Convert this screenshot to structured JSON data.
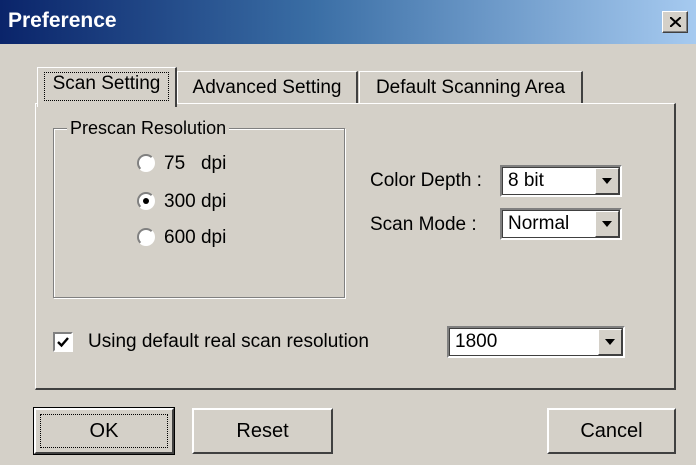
{
  "window": {
    "title": "Preference",
    "close_glyph": "×"
  },
  "tabs": [
    {
      "label": "Scan Setting",
      "active": true
    },
    {
      "label": "Advanced Setting",
      "active": false
    },
    {
      "label": "Default Scanning Area",
      "active": false
    }
  ],
  "prescan": {
    "title": "Prescan Resolution",
    "options": [
      {
        "label": "75   dpi",
        "selected": false
      },
      {
        "label": "300 dpi",
        "selected": true
      },
      {
        "label": "600 dpi",
        "selected": false
      }
    ]
  },
  "color_depth": {
    "label": "Color Depth :",
    "value": "8 bit"
  },
  "scan_mode": {
    "label": "Scan Mode :",
    "value": "Normal"
  },
  "real_scan": {
    "label": "Using default real scan resolution",
    "checked": true,
    "value": "1800"
  },
  "buttons": {
    "ok": "OK",
    "reset": "Reset",
    "cancel": "Cancel"
  },
  "colors": {
    "face": "#d4d0c8",
    "title_start": "#0a246a",
    "title_end": "#a6caf0"
  }
}
